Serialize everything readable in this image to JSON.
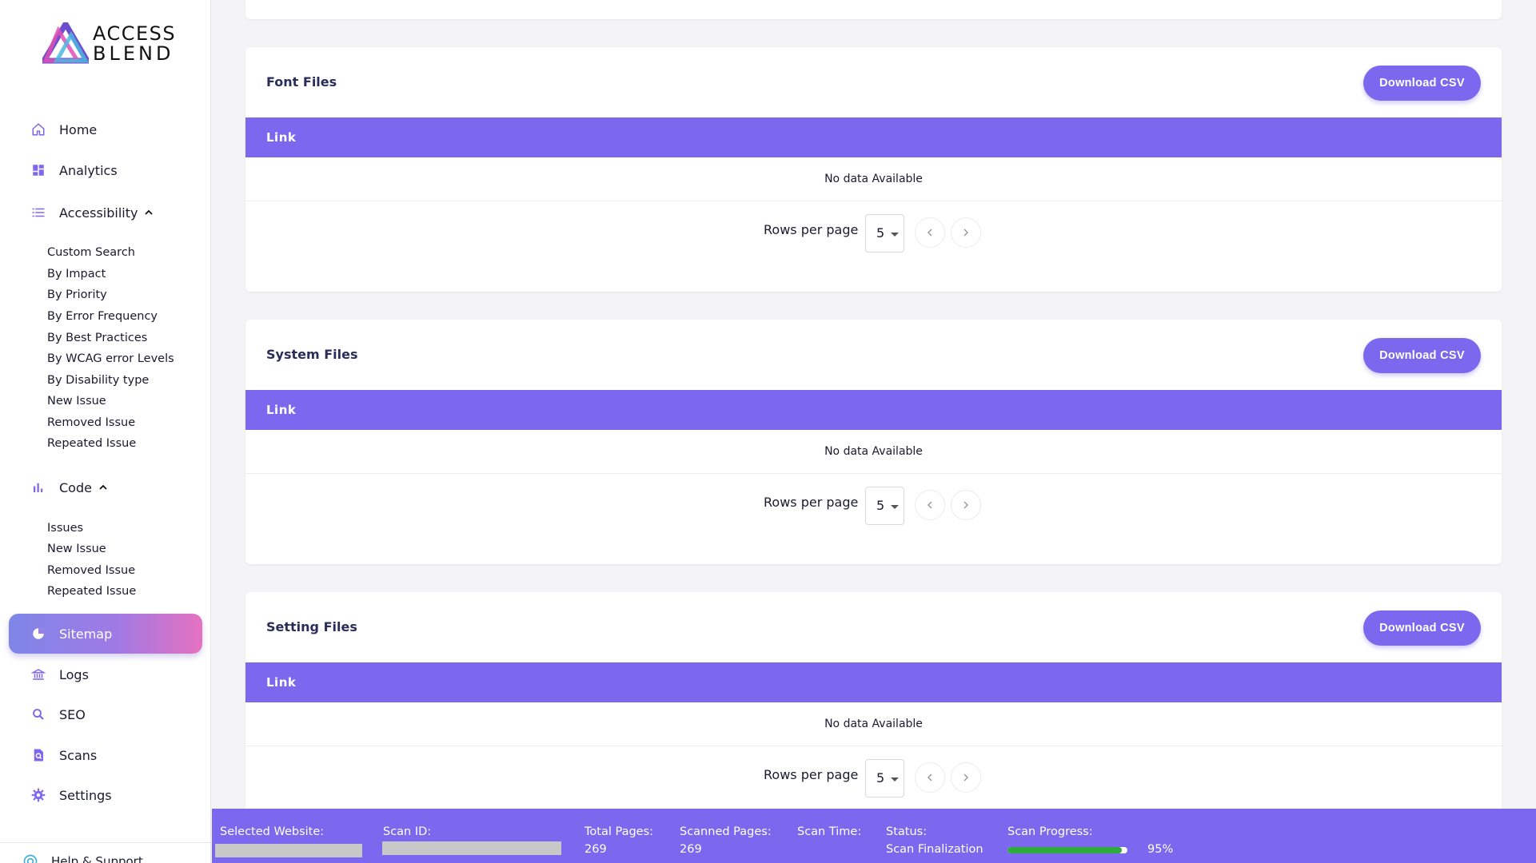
{
  "brand": {
    "line1": "ACCESS",
    "line2": "BLEND"
  },
  "sidebar": {
    "home": "Home",
    "analytics": "Analytics",
    "accessibility": "Accessibility",
    "accessibility_items": [
      "Custom Search",
      "By Impact",
      "By Priority",
      "By Error Frequency",
      "By Best Practices",
      "By WCAG error Levels",
      "By Disability type",
      "New Issue",
      "Removed Issue",
      "Repeated Issue"
    ],
    "code": "Code",
    "code_items": [
      "Issues",
      "New Issue",
      "Removed Issue",
      "Repeated Issue"
    ],
    "sitemap": "Sitemap",
    "logs": "Logs",
    "seo": "SEO",
    "scans": "Scans",
    "settings": "Settings",
    "help": "Help & Support"
  },
  "cards": [
    {
      "title": "Font Files",
      "button": "Download CSV",
      "column": "Link",
      "empty": "No data Available",
      "rows_label": "Rows per page",
      "rows_value": "5"
    },
    {
      "title": "System Files",
      "button": "Download CSV",
      "column": "Link",
      "empty": "No data Available",
      "rows_label": "Rows per page",
      "rows_value": "5"
    },
    {
      "title": "Setting Files",
      "button": "Download CSV",
      "column": "Link",
      "empty": "No data Available",
      "rows_label": "Rows per page",
      "rows_value": "5"
    }
  ],
  "footer": {
    "selected_website_label": "Selected Website:",
    "scan_id_label": "Scan ID:",
    "total_pages_label": "Total Pages:",
    "total_pages": "269",
    "scanned_pages_label": "Scanned Pages:",
    "scanned_pages": "269",
    "scan_time_label": "Scan Time:",
    "status_label": "Status:",
    "status": "Scan Finalization",
    "scan_progress_label": "Scan Progress:",
    "scan_progress_text": "95%",
    "scan_progress": 0.95
  },
  "colors": {
    "accent": "#7b68ee",
    "progress": "#2eaa3e"
  },
  "icons": [
    "home-icon",
    "dashboard-icon",
    "list-icon",
    "bar-chart-icon",
    "pie-chart-icon",
    "bank-icon",
    "search-icon",
    "scan-icon",
    "gear-icon",
    "help-icon",
    "chevron-up-icon",
    "chevron-left-icon",
    "chevron-right-icon"
  ]
}
